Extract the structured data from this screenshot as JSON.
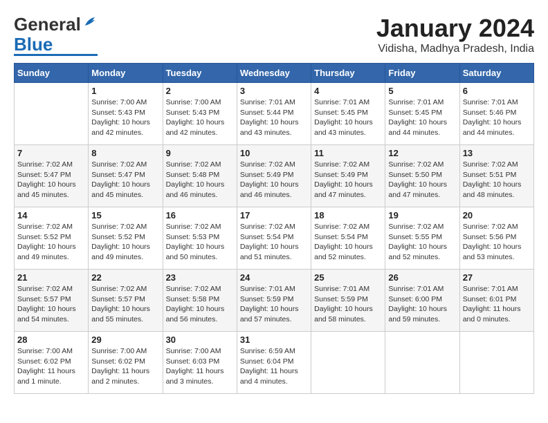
{
  "header": {
    "logo_general": "General",
    "logo_blue": "Blue",
    "title": "January 2024",
    "subtitle": "Vidisha, Madhya Pradesh, India"
  },
  "calendar": {
    "days_of_week": [
      "Sunday",
      "Monday",
      "Tuesday",
      "Wednesday",
      "Thursday",
      "Friday",
      "Saturday"
    ],
    "weeks": [
      [
        {
          "day": "",
          "info": ""
        },
        {
          "day": "1",
          "info": "Sunrise: 7:00 AM\nSunset: 5:43 PM\nDaylight: 10 hours\nand 42 minutes."
        },
        {
          "day": "2",
          "info": "Sunrise: 7:00 AM\nSunset: 5:43 PM\nDaylight: 10 hours\nand 42 minutes."
        },
        {
          "day": "3",
          "info": "Sunrise: 7:01 AM\nSunset: 5:44 PM\nDaylight: 10 hours\nand 43 minutes."
        },
        {
          "day": "4",
          "info": "Sunrise: 7:01 AM\nSunset: 5:45 PM\nDaylight: 10 hours\nand 43 minutes."
        },
        {
          "day": "5",
          "info": "Sunrise: 7:01 AM\nSunset: 5:45 PM\nDaylight: 10 hours\nand 44 minutes."
        },
        {
          "day": "6",
          "info": "Sunrise: 7:01 AM\nSunset: 5:46 PM\nDaylight: 10 hours\nand 44 minutes."
        }
      ],
      [
        {
          "day": "7",
          "info": "Sunrise: 7:02 AM\nSunset: 5:47 PM\nDaylight: 10 hours\nand 45 minutes."
        },
        {
          "day": "8",
          "info": "Sunrise: 7:02 AM\nSunset: 5:47 PM\nDaylight: 10 hours\nand 45 minutes."
        },
        {
          "day": "9",
          "info": "Sunrise: 7:02 AM\nSunset: 5:48 PM\nDaylight: 10 hours\nand 46 minutes."
        },
        {
          "day": "10",
          "info": "Sunrise: 7:02 AM\nSunset: 5:49 PM\nDaylight: 10 hours\nand 46 minutes."
        },
        {
          "day": "11",
          "info": "Sunrise: 7:02 AM\nSunset: 5:49 PM\nDaylight: 10 hours\nand 47 minutes."
        },
        {
          "day": "12",
          "info": "Sunrise: 7:02 AM\nSunset: 5:50 PM\nDaylight: 10 hours\nand 47 minutes."
        },
        {
          "day": "13",
          "info": "Sunrise: 7:02 AM\nSunset: 5:51 PM\nDaylight: 10 hours\nand 48 minutes."
        }
      ],
      [
        {
          "day": "14",
          "info": "Sunrise: 7:02 AM\nSunset: 5:52 PM\nDaylight: 10 hours\nand 49 minutes."
        },
        {
          "day": "15",
          "info": "Sunrise: 7:02 AM\nSunset: 5:52 PM\nDaylight: 10 hours\nand 49 minutes."
        },
        {
          "day": "16",
          "info": "Sunrise: 7:02 AM\nSunset: 5:53 PM\nDaylight: 10 hours\nand 50 minutes."
        },
        {
          "day": "17",
          "info": "Sunrise: 7:02 AM\nSunset: 5:54 PM\nDaylight: 10 hours\nand 51 minutes."
        },
        {
          "day": "18",
          "info": "Sunrise: 7:02 AM\nSunset: 5:54 PM\nDaylight: 10 hours\nand 52 minutes."
        },
        {
          "day": "19",
          "info": "Sunrise: 7:02 AM\nSunset: 5:55 PM\nDaylight: 10 hours\nand 52 minutes."
        },
        {
          "day": "20",
          "info": "Sunrise: 7:02 AM\nSunset: 5:56 PM\nDaylight: 10 hours\nand 53 minutes."
        }
      ],
      [
        {
          "day": "21",
          "info": "Sunrise: 7:02 AM\nSunset: 5:57 PM\nDaylight: 10 hours\nand 54 minutes."
        },
        {
          "day": "22",
          "info": "Sunrise: 7:02 AM\nSunset: 5:57 PM\nDaylight: 10 hours\nand 55 minutes."
        },
        {
          "day": "23",
          "info": "Sunrise: 7:02 AM\nSunset: 5:58 PM\nDaylight: 10 hours\nand 56 minutes."
        },
        {
          "day": "24",
          "info": "Sunrise: 7:01 AM\nSunset: 5:59 PM\nDaylight: 10 hours\nand 57 minutes."
        },
        {
          "day": "25",
          "info": "Sunrise: 7:01 AM\nSunset: 5:59 PM\nDaylight: 10 hours\nand 58 minutes."
        },
        {
          "day": "26",
          "info": "Sunrise: 7:01 AM\nSunset: 6:00 PM\nDaylight: 10 hours\nand 59 minutes."
        },
        {
          "day": "27",
          "info": "Sunrise: 7:01 AM\nSunset: 6:01 PM\nDaylight: 11 hours\nand 0 minutes."
        }
      ],
      [
        {
          "day": "28",
          "info": "Sunrise: 7:00 AM\nSunset: 6:02 PM\nDaylight: 11 hours\nand 1 minute."
        },
        {
          "day": "29",
          "info": "Sunrise: 7:00 AM\nSunset: 6:02 PM\nDaylight: 11 hours\nand 2 minutes."
        },
        {
          "day": "30",
          "info": "Sunrise: 7:00 AM\nSunset: 6:03 PM\nDaylight: 11 hours\nand 3 minutes."
        },
        {
          "day": "31",
          "info": "Sunrise: 6:59 AM\nSunset: 6:04 PM\nDaylight: 11 hours\nand 4 minutes."
        },
        {
          "day": "",
          "info": ""
        },
        {
          "day": "",
          "info": ""
        },
        {
          "day": "",
          "info": ""
        }
      ]
    ]
  }
}
